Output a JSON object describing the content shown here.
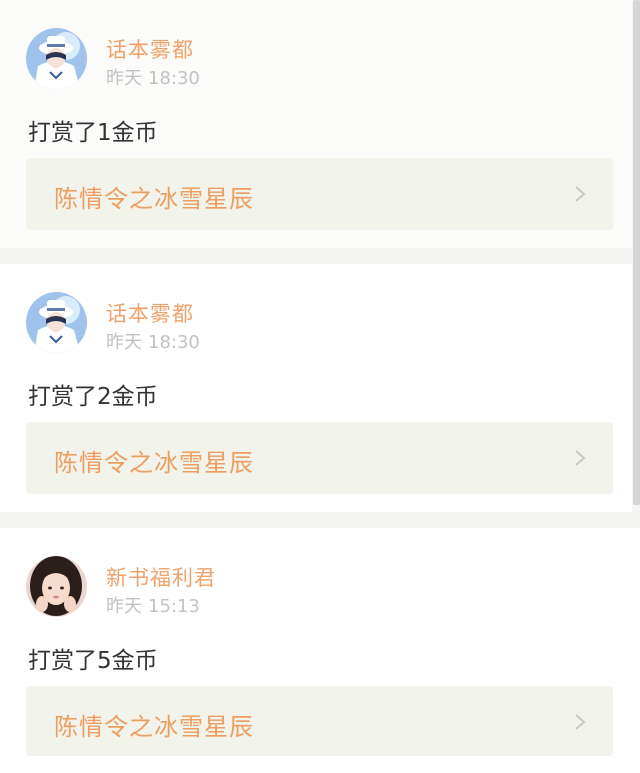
{
  "entries": [
    {
      "username": "话本雾都",
      "date": "昨天",
      "time": "18:30",
      "action": "打赏了1金币",
      "book_title": "陈情令之冰雪星辰",
      "avatar_icon": "anime-avatar-icon"
    },
    {
      "username": "话本雾都",
      "date": "昨天",
      "time": "18:30",
      "action": "打赏了2金币",
      "book_title": "陈情令之冰雪星辰",
      "avatar_icon": "anime-avatar-icon"
    },
    {
      "username": "新书福利君",
      "date": "昨天",
      "time": "15:13",
      "action": "打赏了5金币",
      "book_title": "陈情令之冰雪星辰",
      "avatar_icon": "girl-avatar-icon"
    }
  ],
  "colors": {
    "username": "#f0a26a",
    "book_title": "#ee9d61",
    "book_bg": "#f2f3ea",
    "timestamp": "#c2c2c2",
    "text": "#333333"
  }
}
